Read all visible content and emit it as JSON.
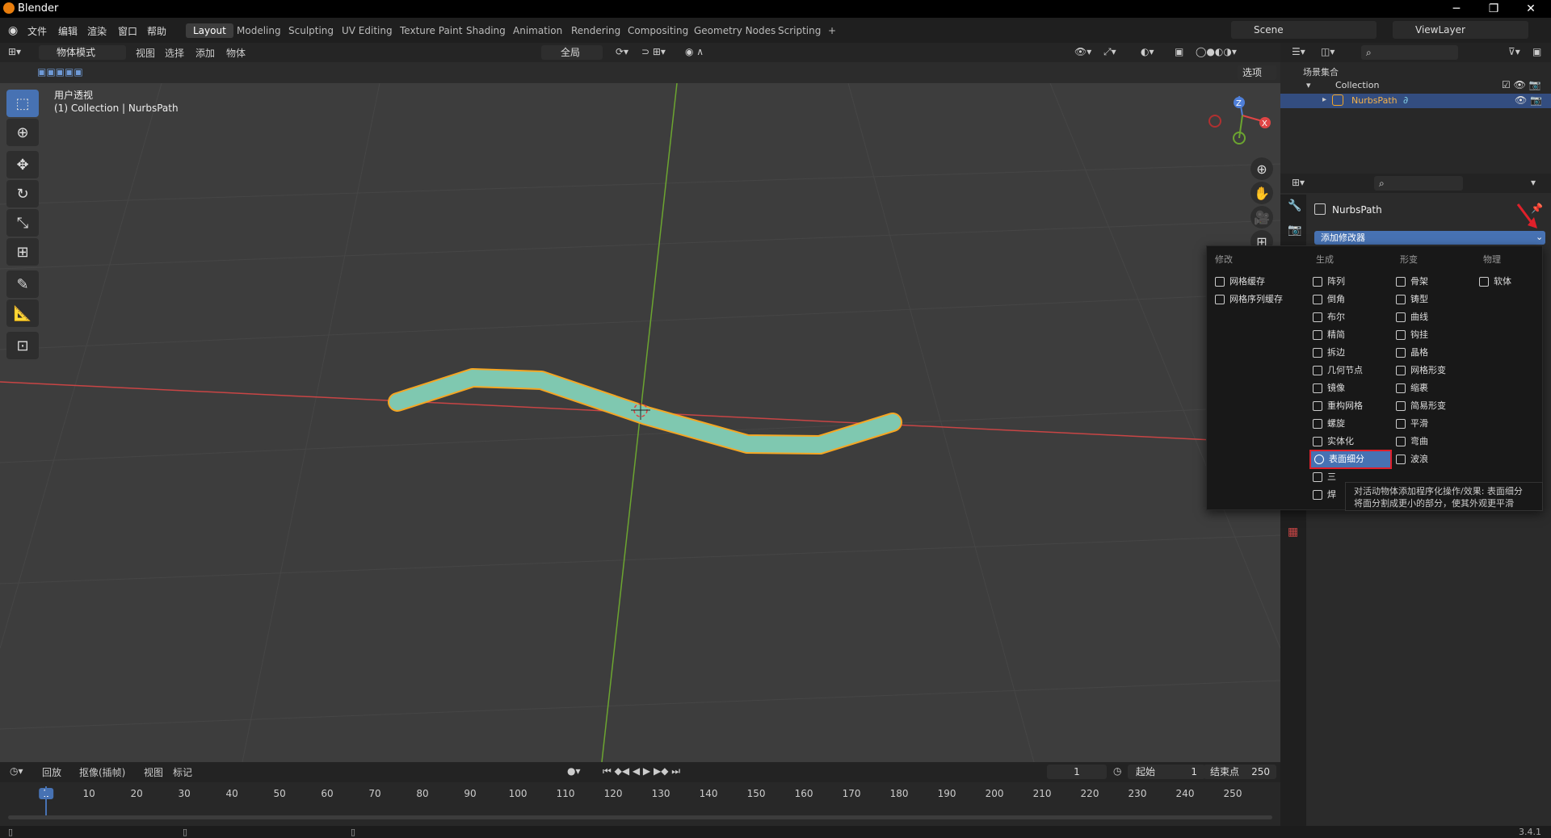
{
  "window": {
    "title": "Blender",
    "minimize": "─",
    "restore": "❐",
    "close": "✕"
  },
  "menu": [
    "文件",
    "编辑",
    "渲染",
    "窗口",
    "帮助"
  ],
  "workspace_tabs": [
    {
      "label": "Layout",
      "active": true
    },
    {
      "label": "Modeling"
    },
    {
      "label": "Sculpting"
    },
    {
      "label": "UV Editing"
    },
    {
      "label": "Texture Paint"
    },
    {
      "label": "Shading"
    },
    {
      "label": "Animation"
    },
    {
      "label": "Rendering"
    },
    {
      "label": "Compositing"
    },
    {
      "label": "Geometry Nodes"
    },
    {
      "label": "Scripting"
    },
    {
      "label": "+"
    }
  ],
  "scene": {
    "name": "Scene",
    "view_layer": "ViewLayer"
  },
  "viewport_header": {
    "mode": "物体模式",
    "menus": [
      "视图",
      "选择",
      "添加",
      "物体"
    ],
    "orientation": "全局",
    "options": "选项"
  },
  "viewport": {
    "view_name": "用户透视",
    "collection_info": "(1) Collection | NurbsPath"
  },
  "gizmo": {
    "z": "Z",
    "x": "X"
  },
  "outliner": {
    "root": "场景集合",
    "collection": "Collection",
    "object": "NurbsPath"
  },
  "properties": {
    "object_name": "NurbsPath",
    "add_modifier": "添加修改器"
  },
  "modifier_menu": {
    "columns": [
      "修改",
      "生成",
      "形变",
      "物理"
    ],
    "edit": [
      "网格缓存",
      "网格序列缓存"
    ],
    "generate": [
      "阵列",
      "倒角",
      "布尔",
      "精简",
      "拆边",
      "几何节点",
      "镜像",
      "重构网格",
      "螺旋",
      "实体化",
      "表面细分",
      "三角化",
      "焊接"
    ],
    "deform": [
      "骨架",
      "铸型",
      "曲线",
      "钩挂",
      "晶格",
      "网格形变",
      "缩裹",
      "简易形变",
      "平滑",
      "弯曲",
      "波浪"
    ],
    "physics": [
      "软体"
    ],
    "selected": "表面细分"
  },
  "tooltip": {
    "line1": "对活动物体添加程序化操作/效果: 表面细分",
    "line2": "将面分割成更小的部分，使其外观更平滑"
  },
  "timeline": {
    "menus": [
      "回放",
      "抠像(插帧)",
      "视图",
      "标记"
    ],
    "current_frame": "1",
    "start_label": "起始",
    "start": "1",
    "end_label": "结束点",
    "end": "250",
    "ticks": [
      "1",
      "10",
      "20",
      "30",
      "40",
      "50",
      "60",
      "70",
      "80",
      "90",
      "100",
      "110",
      "120",
      "130",
      "140",
      "150",
      "160",
      "170",
      "180",
      "190",
      "200",
      "210",
      "220",
      "230",
      "240",
      "250"
    ]
  },
  "status": {
    "version": "3.4.1"
  },
  "colors": {
    "accent": "#4772b3",
    "selection_outline": "#f5a623",
    "object": "#7fc8b0",
    "x_axis": "#c84545",
    "y_axis": "#6ca530",
    "highlight": "#e0202a"
  }
}
